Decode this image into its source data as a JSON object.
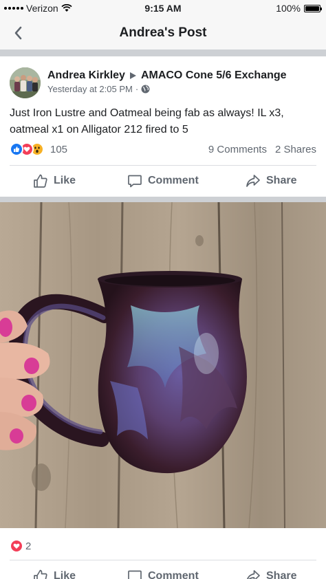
{
  "status": {
    "carrier": "Verizon",
    "time": "9:15 AM",
    "battery": "100%"
  },
  "nav": {
    "title": "Andrea's Post"
  },
  "post": {
    "author": "Andrea Kirkley",
    "group": "AMACO Cone 5/6 Exchange",
    "timestamp": "Yesterday at 2:05 PM",
    "separator": "·",
    "text": "Just Iron Lustre and Oatmeal being fab as always! IL x3, oatmeal x1 on Alligator 212 fired to 5",
    "reaction_count": "105",
    "comments": "9 Comments",
    "shares": "2 Shares",
    "actions": {
      "like": "Like",
      "comment": "Comment",
      "share": "Share"
    }
  },
  "photo_reactions": {
    "count": "2"
  },
  "colors": {
    "like_blue": "#1877f2",
    "love_red": "#f33e58",
    "wow_yellow": "#f7b125",
    "secondary_text": "#606770",
    "divider": "#cdd0d4"
  }
}
